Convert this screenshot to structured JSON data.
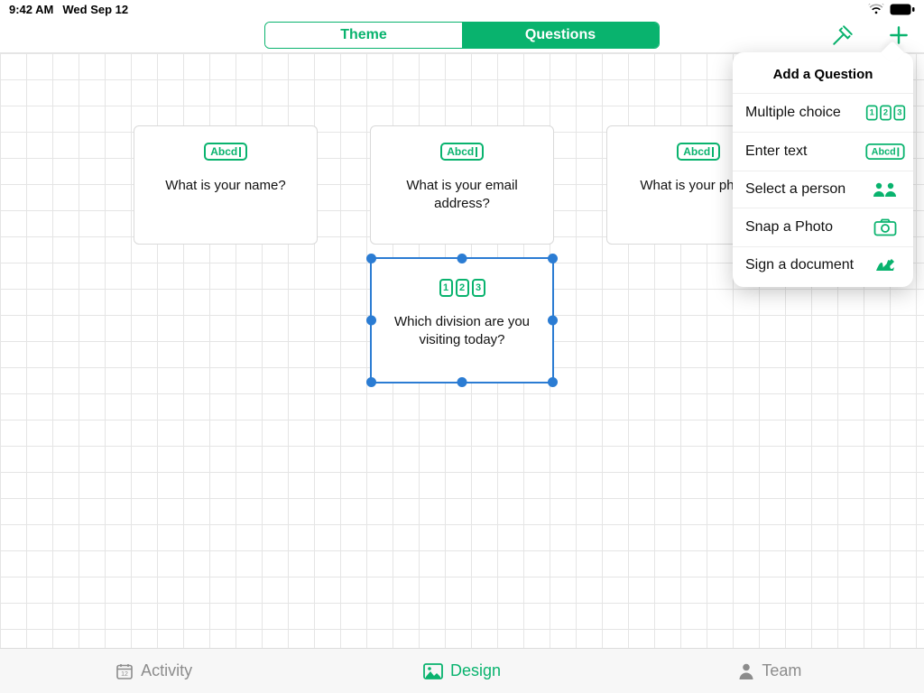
{
  "status": {
    "time": "9:42 AM",
    "date": "Wed Sep 12"
  },
  "toolbar": {
    "theme_label": "Theme",
    "questions_label": "Questions"
  },
  "cards": [
    {
      "type": "text",
      "question": "What is your name?"
    },
    {
      "type": "text",
      "question": "What is your email address?"
    },
    {
      "type": "text",
      "question": "What is your phone"
    },
    {
      "type": "choice",
      "question": "Which division are you visiting today?",
      "selected": true
    }
  ],
  "popover": {
    "title": "Add a Question",
    "options": {
      "multiple_choice": "Multiple choice",
      "enter_text": "Enter text",
      "select_person": "Select a person",
      "snap_photo": "Snap a Photo",
      "sign_document": "Sign a document"
    }
  },
  "tabs": {
    "activity": "Activity",
    "design": "Design",
    "team": "Team"
  },
  "badge": {
    "abcd": "Abcd",
    "d1": "1",
    "d2": "2",
    "d3": "3"
  },
  "colors": {
    "brand": "#09b36e",
    "selection": "#2b7cd3"
  }
}
